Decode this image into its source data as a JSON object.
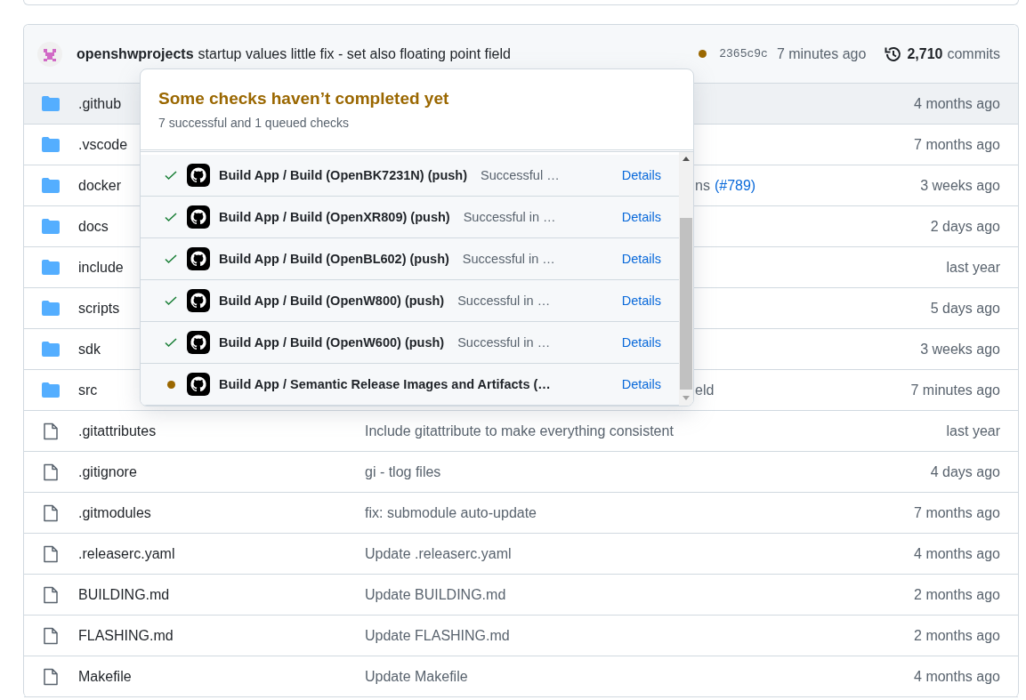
{
  "latest_commit": {
    "author": "openshwprojects",
    "message": "startup values little fix - set also floating point field",
    "kind": "queued",
    "sha": "2365c9c",
    "time": "7 minutes ago",
    "commit_count": "2,710",
    "commit_label": "commits"
  },
  "checks_popover": {
    "title": "Some checks haven’t completed yet",
    "summary": "7 successful and 1 queued checks",
    "checks": [
      {
        "kind": "success",
        "name": "Build App / Build (OpenBK7231N) (push)",
        "description": "Successful …",
        "link": "Details"
      },
      {
        "kind": "success",
        "name": "Build App / Build (OpenXR809) (push)",
        "description": "Successful in …",
        "link": "Details"
      },
      {
        "kind": "success",
        "name": "Build App / Build (OpenBL602) (push)",
        "description": "Successful in …",
        "link": "Details"
      },
      {
        "kind": "success",
        "name": "Build App / Build (OpenW800) (push)",
        "description": "Successful in …",
        "link": "Details"
      },
      {
        "kind": "success",
        "name": "Build App / Build (OpenW600) (push)",
        "description": "Successful in …",
        "link": "Details"
      },
      {
        "kind": "queued",
        "name": "Build App / Semantic Release Images and Artifacts (…",
        "link": "Details"
      }
    ]
  },
  "files": [
    {
      "kind": "dir",
      "name": ".github",
      "hovered": true,
      "date": "4 months ago"
    },
    {
      "kind": "dir",
      "name": ".vscode",
      "hovered": false,
      "date": "7 months ago"
    },
    {
      "kind": "dir",
      "name": "docker",
      "hovered": false,
      "message_end": "ns",
      "message_link": "(#789)",
      "date": "3 weeks ago"
    },
    {
      "kind": "dir",
      "name": "docs",
      "hovered": false,
      "date": "2 days ago"
    },
    {
      "kind": "dir",
      "name": "include",
      "hovered": false,
      "date": "last year"
    },
    {
      "kind": "dir",
      "name": "scripts",
      "hovered": false,
      "date": "5 days ago"
    },
    {
      "kind": "dir",
      "name": "sdk",
      "hovered": false,
      "date": "3 weeks ago"
    },
    {
      "kind": "dir",
      "name": "src",
      "hovered": false,
      "message_end": "eld",
      "date": "7 minutes ago"
    },
    {
      "kind": "file",
      "name": ".gitattributes",
      "hovered": false,
      "message": "Include gitattribute to make everything consistent",
      "date": "last year"
    },
    {
      "kind": "file",
      "name": ".gitignore",
      "hovered": false,
      "message": "gi - tlog files",
      "date": "4 days ago"
    },
    {
      "kind": "file",
      "name": ".gitmodules",
      "hovered": false,
      "message": "fix: submodule auto-update",
      "date": "7 months ago"
    },
    {
      "kind": "file",
      "name": ".releaserc.yaml",
      "hovered": false,
      "message": "Update .releaserc.yaml",
      "date": "4 months ago"
    },
    {
      "kind": "file",
      "name": "BUILDING.md",
      "hovered": false,
      "message": "Update BUILDING.md",
      "date": "2 months ago"
    },
    {
      "kind": "file",
      "name": "FLASHING.md",
      "hovered": false,
      "message": "Update FLASHING.md",
      "date": "2 months ago"
    },
    {
      "kind": "file",
      "name": "Makefile",
      "hovered": false,
      "message": "Update Makefile",
      "date": "4 months ago"
    }
  ]
}
